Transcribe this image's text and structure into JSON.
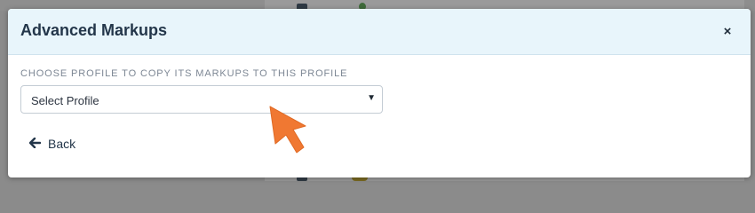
{
  "modal": {
    "title": "Advanced Markups",
    "close_label": "×"
  },
  "form": {
    "profile_label": "CHOOSE PROFILE TO COPY ITS MARKUPS TO THIS PROFILE",
    "profile_select": {
      "selected": "Select Profile",
      "caret": "▼"
    }
  },
  "footer": {
    "back_icon": "🡐",
    "back_label": "Back"
  },
  "icons": {
    "close": "close-icon",
    "back": "arrow-left-icon",
    "caret": "caret-down-icon",
    "pointer": "pointer-arrow-icon"
  },
  "colors": {
    "header_bg": "#e8f5fb",
    "title": "#23364a",
    "pointer": "#f07832"
  }
}
